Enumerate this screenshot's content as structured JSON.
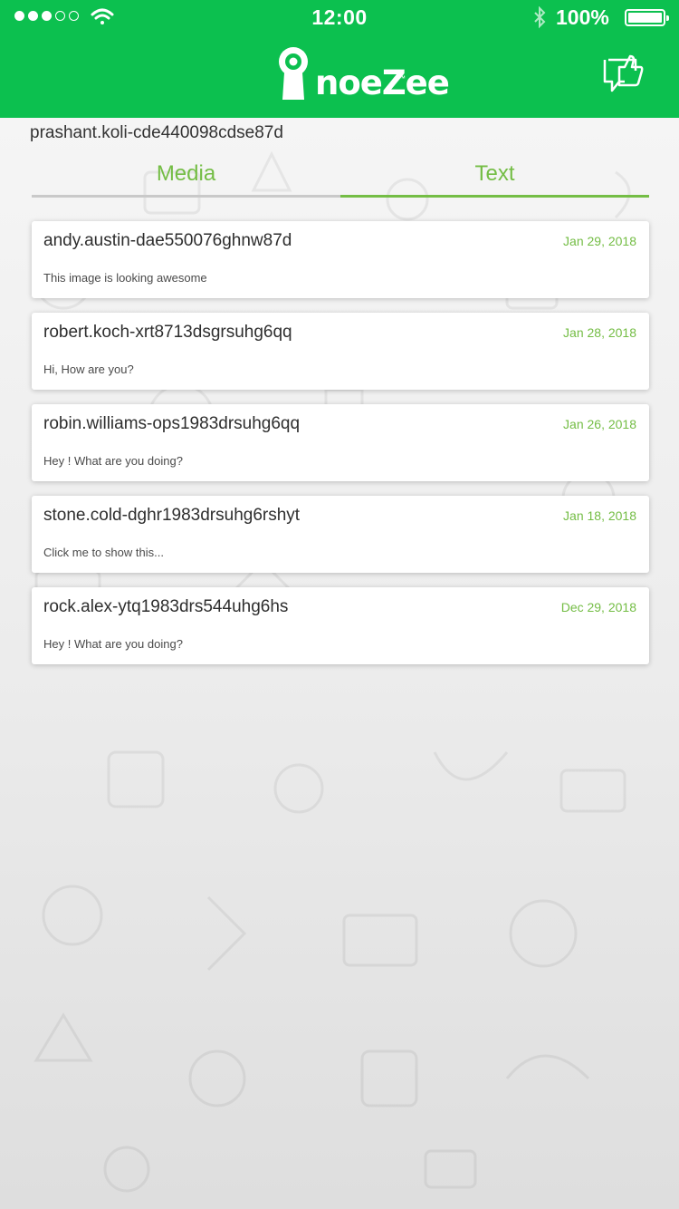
{
  "status_bar": {
    "time": "12:00",
    "battery": "100%",
    "signal_icon": "signal-dots-icon",
    "wifi_icon": "wifi-icon",
    "bluetooth_icon": "bluetooth-icon",
    "battery_icon": "battery-icon"
  },
  "header": {
    "logo_text": "noeZee",
    "logo_tm": "™",
    "action_icon": "thumbs-up-chat-icon"
  },
  "user_id": "prashant.koli-cde440098cdse87d",
  "tabs": [
    {
      "label": "Media",
      "active": false
    },
    {
      "label": "Text",
      "active": true
    }
  ],
  "messages": [
    {
      "name": "andy.austin-dae550076ghnw87d",
      "date": "Jan 29, 2018",
      "text": "This image is looking awesome"
    },
    {
      "name": "robert.koch-xrt8713dsgrsuhg6qq",
      "date": "Jan 28, 2018",
      "text": "Hi, How are you?"
    },
    {
      "name": "robin.williams-ops1983drsuhg6qq",
      "date": "Jan 26, 2018",
      "text": "Hey ! What are you doing?"
    },
    {
      "name": "stone.cold-dghr1983drsuhg6rshyt",
      "date": "Jan 18, 2018",
      "text": "Click me to show this..."
    },
    {
      "name": "rock.alex-ytq1983drs544uhg6hs",
      "date": "Dec 29, 2018",
      "text": "Hey ! What are you doing?"
    }
  ],
  "colors": {
    "brand_green": "#0cc04f",
    "accent_green": "#74bd45",
    "tab_inactive_line": "#c9c9c9"
  }
}
